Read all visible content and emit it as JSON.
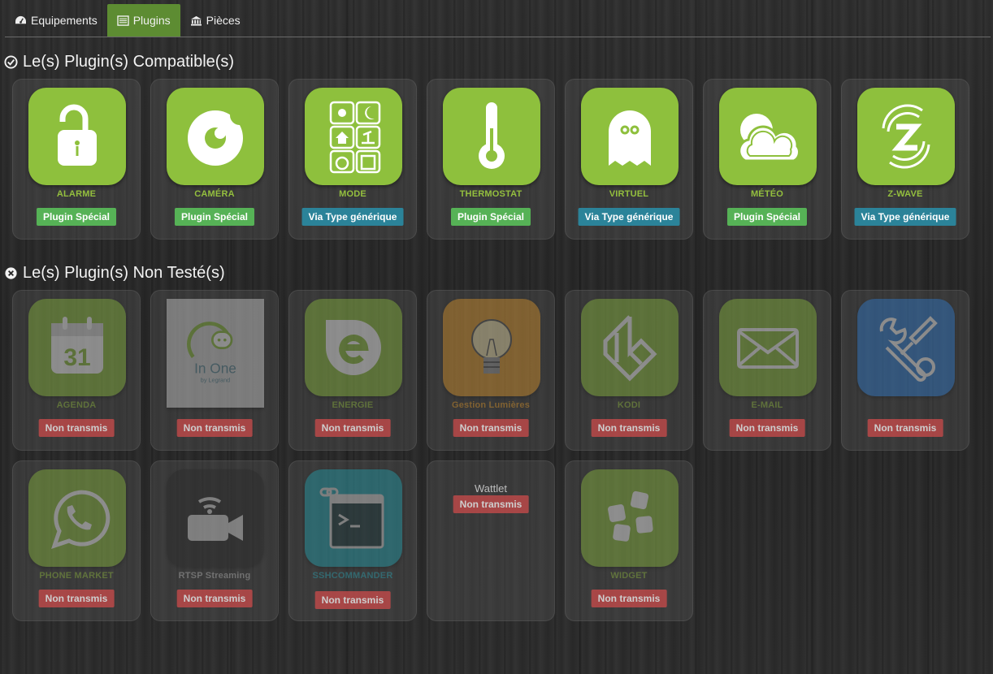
{
  "tabs": [
    {
      "label": "Equipements",
      "icon": "dashboard-icon"
    },
    {
      "label": "Plugins",
      "icon": "list-icon",
      "active": true
    },
    {
      "label": "Pièces",
      "icon": "bank-icon"
    }
  ],
  "sections": {
    "compatible": {
      "title": "Le(s) Plugin(s) Compatible(s)",
      "icon": "check-circle-icon"
    },
    "untested": {
      "title": "Le(s) Plugin(s) Non Testé(s)",
      "icon": "times-circle-icon"
    }
  },
  "compatible_plugins": [
    {
      "name": "ALARME",
      "badge": "Plugin Spécial",
      "icon": "padlock-icon"
    },
    {
      "name": "CAMÉRA",
      "badge": "Plugin Spécial",
      "icon": "camera-icon"
    },
    {
      "name": "MODE",
      "badge": "Via Type générique",
      "icon": "mode-grid-icon"
    },
    {
      "name": "THERMOSTAT",
      "badge": "Plugin Spécial",
      "icon": "thermometer-icon"
    },
    {
      "name": "VIRTUEL",
      "badge": "Via Type générique",
      "icon": "ghost-icon"
    },
    {
      "name": "MÉTÉO",
      "badge": "Plugin Spécial",
      "icon": "weather-icon"
    },
    {
      "name": "Z-WAVE",
      "badge": "Via Type générique",
      "icon": "zwave-icon"
    }
  ],
  "untested_plugins": [
    {
      "name": "AGENDA",
      "badge": "Non transmis",
      "icon": "calendar-icon"
    },
    {
      "name": "",
      "badge": "Non transmis",
      "icon": "inone-logo-icon",
      "logo_text": "In One",
      "logo_sub": "by Legrand"
    },
    {
      "name": "ENERGIE",
      "badge": "Non transmis",
      "icon": "energie-icon"
    },
    {
      "name": "Gestion Lumières",
      "badge": "Non transmis",
      "icon": "bulb-icon"
    },
    {
      "name": "KODI",
      "badge": "Non transmis",
      "icon": "kodi-icon"
    },
    {
      "name": "E-MAIL",
      "badge": "Non transmis",
      "icon": "envelope-icon"
    },
    {
      "name": "",
      "badge": "Non transmis",
      "icon": "tools-icon"
    },
    {
      "name": "PHONE MARKET",
      "badge": "Non transmis",
      "icon": "whatsapp-icon"
    },
    {
      "name": "RTSP Streaming",
      "badge": "Non transmis",
      "icon": "video-camera-icon"
    },
    {
      "name": "SSHCOMMANDER",
      "badge": "Non transmis",
      "icon": "terminal-icon"
    },
    {
      "name": "Wattlet",
      "badge": "Non transmis",
      "icon": ""
    },
    {
      "name": "WIDGET",
      "badge": "Non transmis",
      "icon": "widget-icon"
    }
  ],
  "colors": {
    "accent_green": "#8ec03d",
    "tab_active": "#5d8c32",
    "badge_special": "#56b256",
    "badge_generic": "#2b8399",
    "badge_none": "#cc4b4b"
  }
}
